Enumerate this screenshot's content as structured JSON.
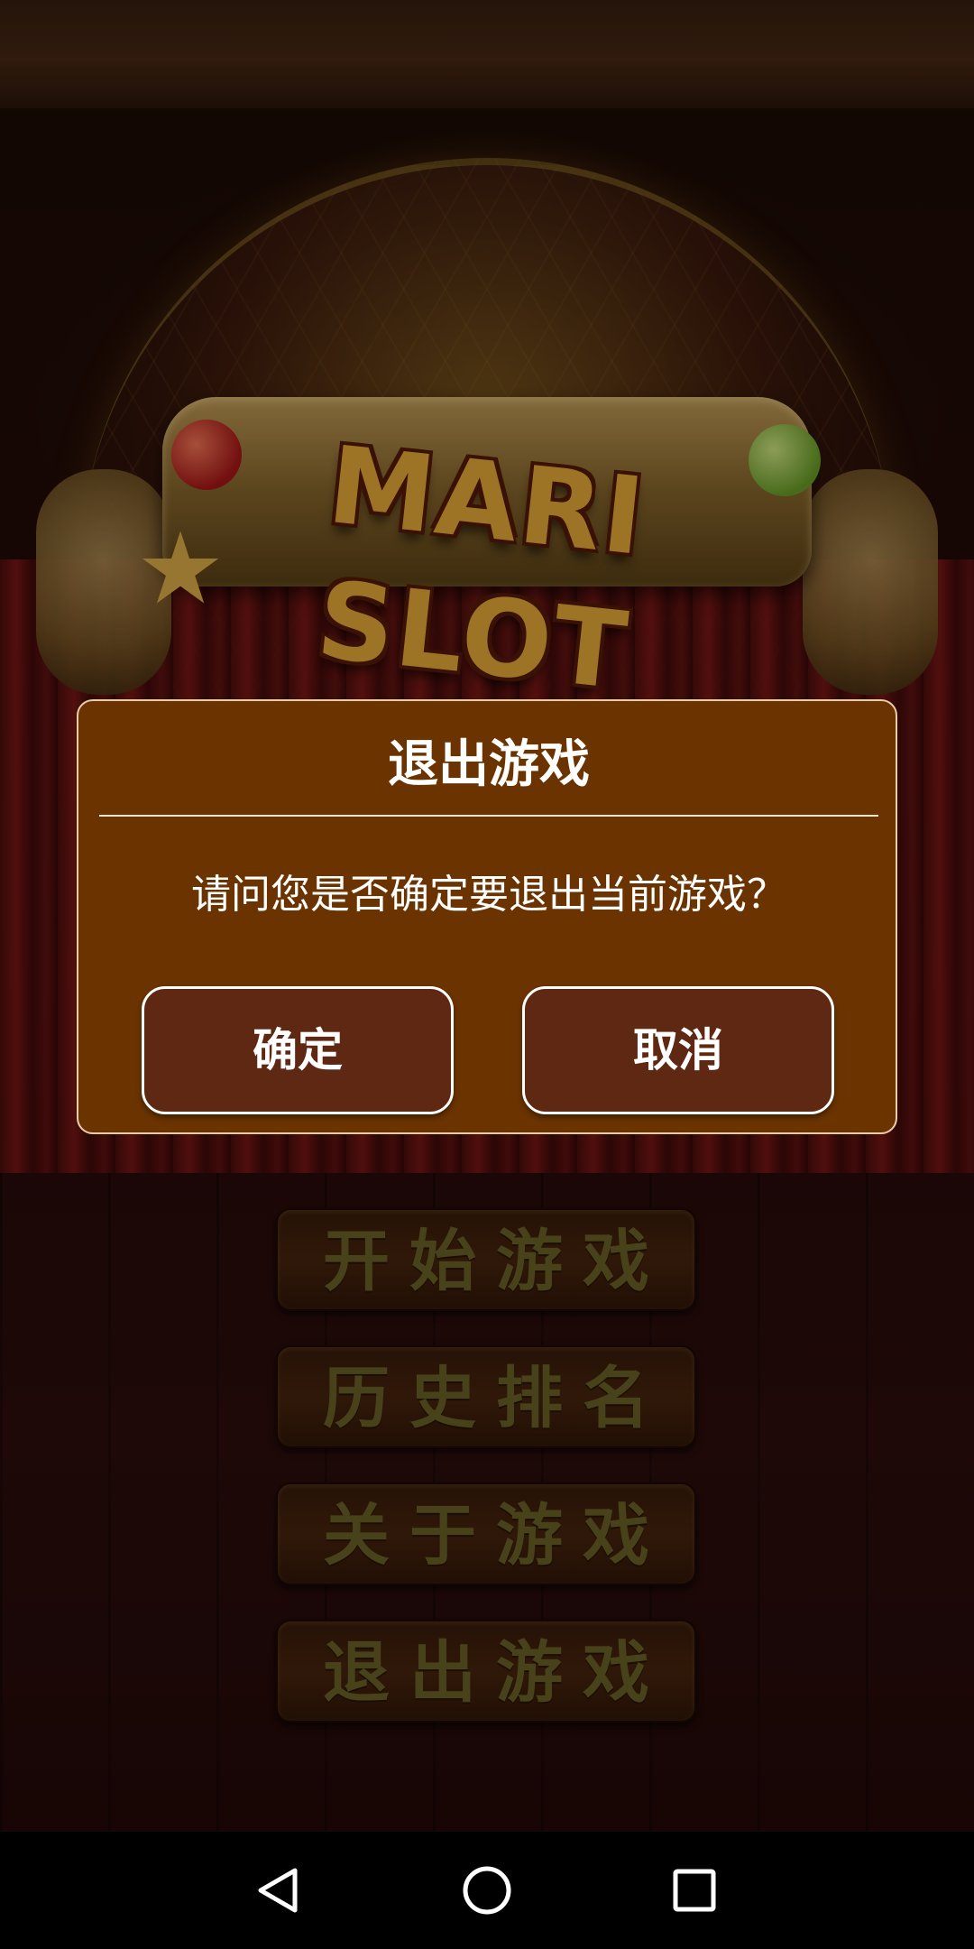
{
  "game": {
    "logo_text": "MARI SLOT"
  },
  "menu": {
    "items": [
      {
        "label": "开始游戏"
      },
      {
        "label": "历史排名"
      },
      {
        "label": "关于游戏"
      },
      {
        "label": "退出游戏"
      }
    ],
    "text_color": "#6d6628"
  },
  "dialog": {
    "title": "退出游戏",
    "message": "请问您是否确定要退出当前游戏？",
    "confirm_label": "确定",
    "cancel_label": "取消",
    "background_color": "#6a3300",
    "button_color": "#5e2813"
  },
  "nav_bar": {
    "back_icon": "triangle-back-icon",
    "home_icon": "circle-home-icon",
    "recents_icon": "square-recents-icon"
  }
}
